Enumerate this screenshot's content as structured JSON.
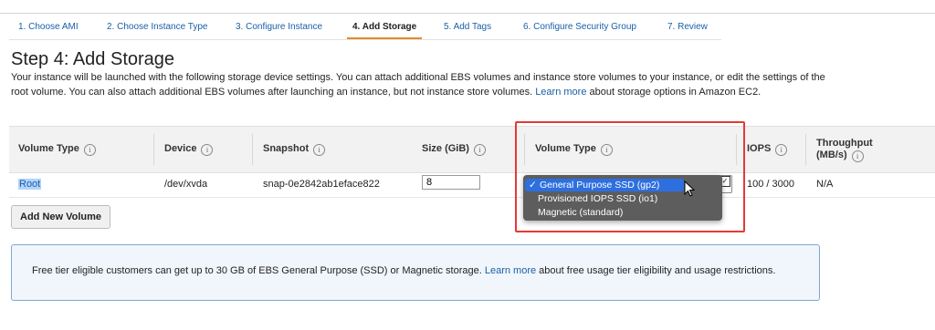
{
  "tabs": [
    {
      "label": "1. Choose AMI",
      "active": false
    },
    {
      "label": "2. Choose Instance Type",
      "active": false
    },
    {
      "label": "3. Configure Instance",
      "active": false
    },
    {
      "label": "4. Add Storage",
      "active": true
    },
    {
      "label": "5. Add Tags",
      "active": false
    },
    {
      "label": "6. Configure Security Group",
      "active": false
    },
    {
      "label": "7. Review",
      "active": false
    }
  ],
  "step": {
    "title": "Step 4: Add Storage",
    "description_part1": "Your instance will be launched with the following storage device settings. You can attach additional EBS volumes and instance store volumes to your instance, or edit the settings of the root volume. You can also attach additional EBS volumes after launching an instance, but not instance store volumes. ",
    "learn_more": "Learn more",
    "description_part2": " about storage options in Amazon EC2."
  },
  "table": {
    "headers": {
      "volume_type": "Volume Type",
      "device": "Device",
      "snapshot": "Snapshot",
      "size": "Size (GiB)",
      "volume_type2": "Volume Type",
      "iops": "IOPS",
      "throughput_line1": "Throughput",
      "throughput_line2": "(MB/s)",
      "info_glyph": "i"
    },
    "row": {
      "volume_type": "Root",
      "device": "/dev/xvda",
      "snapshot": "snap-0e2842ab1eface822",
      "size": "8",
      "iops": "100 / 3000",
      "throughput": "N/A"
    }
  },
  "dropdown": {
    "options": [
      {
        "label": "General Purpose SSD (gp2)",
        "selected": true
      },
      {
        "label": "Provisioned IOPS SSD (io1)",
        "selected": false
      },
      {
        "label": "Magnetic (standard)",
        "selected": false
      }
    ],
    "check_glyph": "✓",
    "arrow_glyph": "✓"
  },
  "add_volume_label": "Add New Volume",
  "info_box": {
    "text_part1": "Free tier eligible customers can get up to 30 GB of EBS General Purpose (SSD) or Magnetic storage. ",
    "learn_more": "Learn more",
    "text_part2": " about free usage tier eligibility and usage restrictions."
  },
  "colors": {
    "accent_tab": "#e48a2a",
    "link": "#1a5fa8",
    "highlight_box": "#e53935",
    "dropdown_selected": "#2d6fe0"
  }
}
